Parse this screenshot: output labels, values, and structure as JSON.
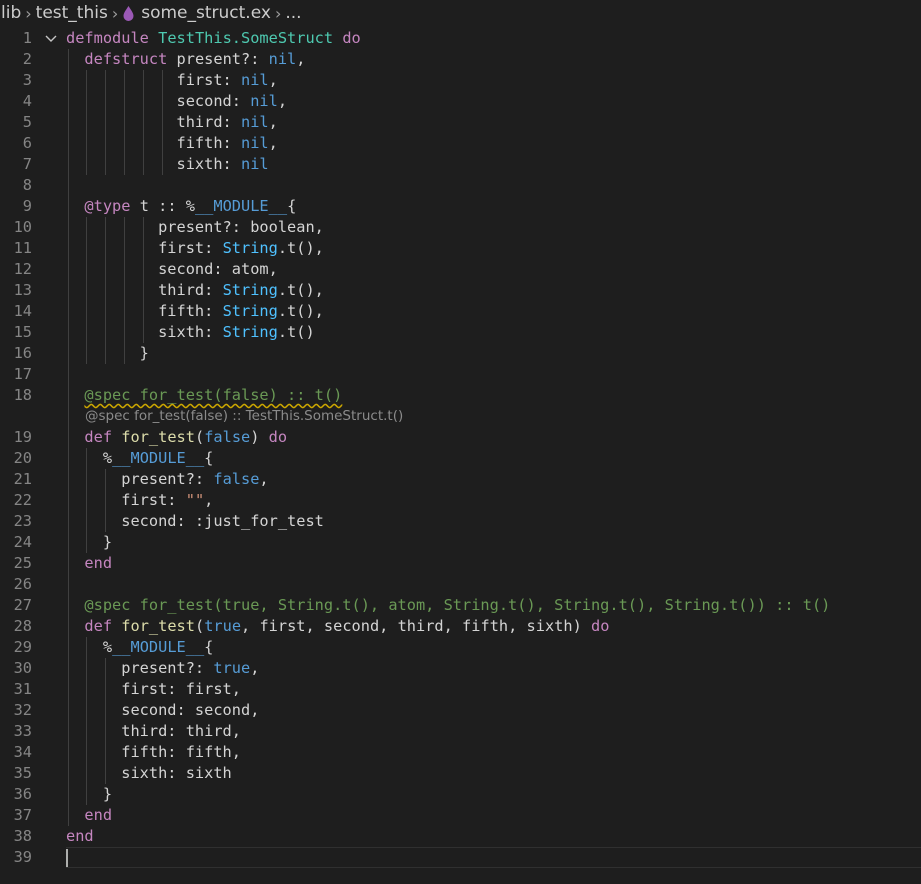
{
  "breadcrumb": {
    "items": [
      "lib",
      "test_this",
      "some_struct.ex",
      "..."
    ]
  },
  "inlay_hint": "@spec for_test(false) :: TestThis.SomeStruct.t()",
  "colors": {
    "background": "#1e1e1e",
    "keyword": "#c586c0",
    "module": "#4ec9b0",
    "constant": "#569cd6",
    "function": "#dcdcaa",
    "string": "#ce9178",
    "type": "#4fc1ff",
    "spec": "#6a9955",
    "elixir_drop": "#9b59b6"
  },
  "icons": {
    "file": "elixir-drop-icon",
    "fold": "chevron-down-icon",
    "separator": "chevron-right-icon"
  },
  "lines": [
    {
      "n": "1",
      "tokens": [
        [
          "defmodule",
          "kw"
        ],
        [
          " ",
          "plain"
        ],
        [
          "TestThis.SomeStruct",
          "mod"
        ],
        [
          " ",
          "plain"
        ],
        [
          "do",
          "kw"
        ]
      ]
    },
    {
      "n": "2",
      "tokens": [
        [
          "  ",
          "plain"
        ],
        [
          "defstruct",
          "kw"
        ],
        [
          " present?: ",
          "plain"
        ],
        [
          "nil",
          "nil"
        ],
        [
          ",",
          "plain"
        ]
      ]
    },
    {
      "n": "3",
      "tokens": [
        [
          "            first: ",
          "plain"
        ],
        [
          "nil",
          "nil"
        ],
        [
          ",",
          "plain"
        ]
      ]
    },
    {
      "n": "4",
      "tokens": [
        [
          "            second: ",
          "plain"
        ],
        [
          "nil",
          "nil"
        ],
        [
          ",",
          "plain"
        ]
      ]
    },
    {
      "n": "5",
      "tokens": [
        [
          "            third: ",
          "plain"
        ],
        [
          "nil",
          "nil"
        ],
        [
          ",",
          "plain"
        ]
      ]
    },
    {
      "n": "6",
      "tokens": [
        [
          "            fifth: ",
          "plain"
        ],
        [
          "nil",
          "nil"
        ],
        [
          ",",
          "plain"
        ]
      ]
    },
    {
      "n": "7",
      "tokens": [
        [
          "            sixth: ",
          "plain"
        ],
        [
          "nil",
          "nil"
        ]
      ]
    },
    {
      "n": "8",
      "tokens": []
    },
    {
      "n": "9",
      "tokens": [
        [
          "  ",
          "plain"
        ],
        [
          "@type",
          "kw"
        ],
        [
          " t :: %",
          "plain"
        ],
        [
          "__MODULE__",
          "nil"
        ],
        [
          "{",
          "plain"
        ]
      ]
    },
    {
      "n": "10",
      "tokens": [
        [
          "          present?: boolean,",
          "plain"
        ]
      ]
    },
    {
      "n": "11",
      "tokens": [
        [
          "          first: ",
          "plain"
        ],
        [
          "String",
          "typ"
        ],
        [
          ".t(),",
          "plain"
        ]
      ]
    },
    {
      "n": "12",
      "tokens": [
        [
          "          second: atom,",
          "plain"
        ]
      ]
    },
    {
      "n": "13",
      "tokens": [
        [
          "          third: ",
          "plain"
        ],
        [
          "String",
          "typ"
        ],
        [
          ".t(),",
          "plain"
        ]
      ]
    },
    {
      "n": "14",
      "tokens": [
        [
          "          fifth: ",
          "plain"
        ],
        [
          "String",
          "typ"
        ],
        [
          ".t(),",
          "plain"
        ]
      ]
    },
    {
      "n": "15",
      "tokens": [
        [
          "          sixth: ",
          "plain"
        ],
        [
          "String",
          "typ"
        ],
        [
          ".t()",
          "plain"
        ]
      ]
    },
    {
      "n": "16",
      "tokens": [
        [
          "        }",
          "plain"
        ]
      ]
    },
    {
      "n": "17",
      "tokens": []
    },
    {
      "n": "18",
      "tokens": [
        [
          "  ",
          "plain"
        ],
        [
          "@spec for_test(false) :: t()",
          "spec squig"
        ]
      ]
    },
    {
      "n": "19",
      "tokens": [
        [
          "  ",
          "plain"
        ],
        [
          "def",
          "kw"
        ],
        [
          " ",
          "plain"
        ],
        [
          "for_test",
          "fn"
        ],
        [
          "(",
          "plain"
        ],
        [
          "false",
          "nil"
        ],
        [
          ") ",
          "plain"
        ],
        [
          "do",
          "kw"
        ]
      ]
    },
    {
      "n": "20",
      "tokens": [
        [
          "    %",
          "plain"
        ],
        [
          "__MODULE__",
          "nil"
        ],
        [
          "{",
          "plain"
        ]
      ]
    },
    {
      "n": "21",
      "tokens": [
        [
          "      present?: ",
          "plain"
        ],
        [
          "false",
          "nil"
        ],
        [
          ",",
          "plain"
        ]
      ]
    },
    {
      "n": "22",
      "tokens": [
        [
          "      first: ",
          "plain"
        ],
        [
          "\"\"",
          "str"
        ],
        [
          ",",
          "plain"
        ]
      ]
    },
    {
      "n": "23",
      "tokens": [
        [
          "      second: :just_for_test",
          "plain"
        ]
      ]
    },
    {
      "n": "24",
      "tokens": [
        [
          "    }",
          "plain"
        ]
      ]
    },
    {
      "n": "25",
      "tokens": [
        [
          "  ",
          "plain"
        ],
        [
          "end",
          "kw"
        ]
      ]
    },
    {
      "n": "26",
      "tokens": []
    },
    {
      "n": "27",
      "tokens": [
        [
          "  ",
          "plain"
        ],
        [
          "@spec for_test(true, String.t(), atom, String.t(), String.t(), String.t()) :: t()",
          "spec"
        ]
      ]
    },
    {
      "n": "28",
      "tokens": [
        [
          "  ",
          "plain"
        ],
        [
          "def",
          "kw"
        ],
        [
          " ",
          "plain"
        ],
        [
          "for_test",
          "fn"
        ],
        [
          "(",
          "plain"
        ],
        [
          "true",
          "nil"
        ],
        [
          ", first, second, third, fifth, sixth) ",
          "plain"
        ],
        [
          "do",
          "kw"
        ]
      ]
    },
    {
      "n": "29",
      "tokens": [
        [
          "    %",
          "plain"
        ],
        [
          "__MODULE__",
          "nil"
        ],
        [
          "{",
          "plain"
        ]
      ]
    },
    {
      "n": "30",
      "tokens": [
        [
          "      present?: ",
          "plain"
        ],
        [
          "true",
          "nil"
        ],
        [
          ",",
          "plain"
        ]
      ]
    },
    {
      "n": "31",
      "tokens": [
        [
          "      first: first,",
          "plain"
        ]
      ]
    },
    {
      "n": "32",
      "tokens": [
        [
          "      second: second,",
          "plain"
        ]
      ]
    },
    {
      "n": "33",
      "tokens": [
        [
          "      third: third,",
          "plain"
        ]
      ]
    },
    {
      "n": "34",
      "tokens": [
        [
          "      fifth: fifth,",
          "plain"
        ]
      ]
    },
    {
      "n": "35",
      "tokens": [
        [
          "      sixth: sixth",
          "plain"
        ]
      ]
    },
    {
      "n": "36",
      "tokens": [
        [
          "    }",
          "plain"
        ]
      ]
    },
    {
      "n": "37",
      "tokens": [
        [
          "  ",
          "plain"
        ],
        [
          "end",
          "kw"
        ]
      ]
    },
    {
      "n": "38",
      "tokens": [
        [
          "end",
          "kw"
        ]
      ]
    },
    {
      "n": "39",
      "tokens": []
    }
  ]
}
